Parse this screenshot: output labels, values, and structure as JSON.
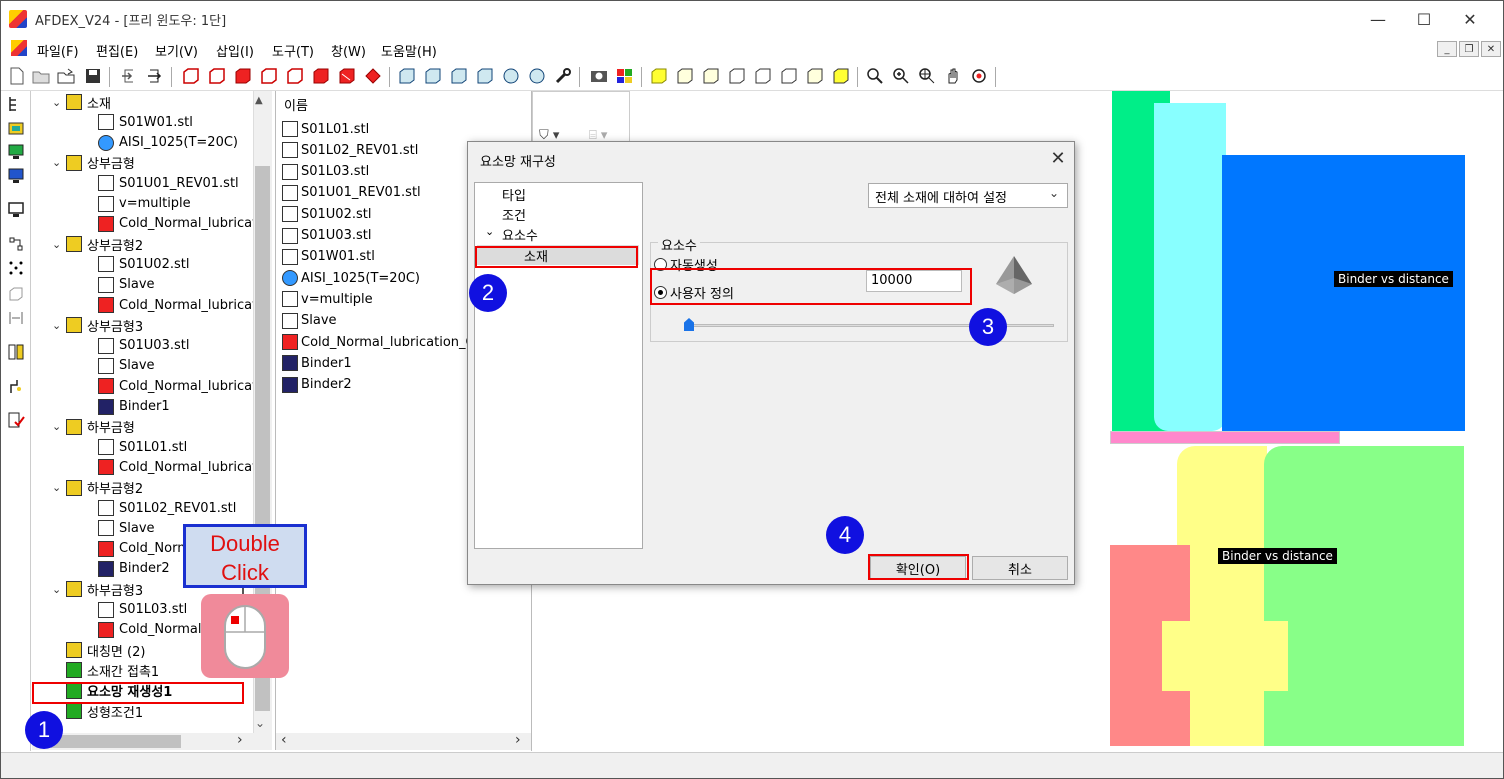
{
  "window": {
    "title": "AFDEX_V24 - [프리 윈도우: 1단]",
    "minimize": "—",
    "maximize": "☐",
    "close": "✕"
  },
  "menu": [
    "파일(F)",
    "편집(E)",
    "보기(V)",
    "삽입(I)",
    "도구(T)",
    "창(W)",
    "도움말(H)"
  ],
  "tree": {
    "nodes": [
      {
        "label": "소재",
        "level": 0,
        "icon": "material-cylinder-icon"
      },
      {
        "label": "S01W01.stl",
        "level": 1,
        "icon": "stl-file-icon"
      },
      {
        "label": "AISI_1025(T=20C)",
        "level": 1,
        "icon": "material-property-icon"
      },
      {
        "label": "상부금형",
        "level": 0,
        "icon": "upper-die-icon"
      },
      {
        "label": "S01U01_REV01.stl",
        "level": 1,
        "icon": "die-stl-icon"
      },
      {
        "label": "v=multiple",
        "level": 1,
        "icon": "press-icon"
      },
      {
        "label": "Cold_Normal_lubrication",
        "level": 1,
        "icon": "lubrication-icon"
      },
      {
        "label": "상부금형2",
        "level": 0,
        "icon": "upper-die-icon"
      },
      {
        "label": "S01U02.stl",
        "level": 1,
        "icon": "die-stl-icon"
      },
      {
        "label": "Slave",
        "level": 1,
        "icon": "press-icon"
      },
      {
        "label": "Cold_Normal_lubrication",
        "level": 1,
        "icon": "lubrication-icon"
      },
      {
        "label": "상부금형3",
        "level": 0,
        "icon": "upper-die-icon"
      },
      {
        "label": "S01U03.stl",
        "level": 1,
        "icon": "die-stl-icon"
      },
      {
        "label": "Slave",
        "level": 1,
        "icon": "press-icon"
      },
      {
        "label": "Cold_Normal_lubrication",
        "level": 1,
        "icon": "lubrication-icon"
      },
      {
        "label": "Binder1",
        "level": 1,
        "icon": "binder-icon"
      },
      {
        "label": "하부금형",
        "level": 0,
        "icon": "lower-die-icon"
      },
      {
        "label": "S01L01.stl",
        "level": 1,
        "icon": "die-stl-icon"
      },
      {
        "label": "Cold_Normal_lubrication",
        "level": 1,
        "icon": "lubrication-icon"
      },
      {
        "label": "하부금형2",
        "level": 0,
        "icon": "lower-die-icon"
      },
      {
        "label": "S01L02_REV01.stl",
        "level": 1,
        "icon": "die-stl-icon"
      },
      {
        "label": "Slave",
        "level": 1,
        "icon": "press-icon"
      },
      {
        "label": "Cold_Normal_lubrication",
        "level": 1,
        "icon": "lubrication-icon"
      },
      {
        "label": "Binder2",
        "level": 1,
        "icon": "binder-icon"
      },
      {
        "label": "하부금형3",
        "level": 0,
        "icon": "lower-die-icon"
      },
      {
        "label": "S01L03.stl",
        "level": 1,
        "icon": "die-stl-icon"
      },
      {
        "label": "Cold_Normal_lubrication",
        "level": 1,
        "icon": "lubrication-icon"
      },
      {
        "label": "대칭면 (2)",
        "level": 0,
        "icon": "symmetry-plane-icon"
      },
      {
        "label": "소재간 접촉1",
        "level": 0,
        "icon": "contact-icon"
      },
      {
        "label": "요소망 재생성1",
        "level": 0,
        "icon": "remesh-icon"
      },
      {
        "label": "성형조건1",
        "level": 0,
        "icon": "forming-condition-icon"
      }
    ]
  },
  "list": {
    "header": "이름",
    "rows": [
      {
        "label": "S01L01.stl",
        "icon": "stl-file-icon"
      },
      {
        "label": "S01L02_REV01.stl",
        "icon": "stl-file-icon"
      },
      {
        "label": "S01L03.stl",
        "icon": "stl-file-icon"
      },
      {
        "label": "S01U01_REV01.stl",
        "icon": "stl-file-icon"
      },
      {
        "label": "S01U02.stl",
        "icon": "stl-file-icon"
      },
      {
        "label": "S01U03.stl",
        "icon": "stl-file-icon"
      },
      {
        "label": "S01W01.stl",
        "icon": "stl-file-icon"
      },
      {
        "label": "AISI_1025(T=20C)",
        "icon": "material-property-icon"
      },
      {
        "label": "v=multiple",
        "icon": "press-icon"
      },
      {
        "label": "Slave",
        "icon": "press-icon"
      },
      {
        "label": "Cold_Normal_lubrication_Co",
        "icon": "lubrication-icon"
      },
      {
        "label": "Binder1",
        "icon": "binder-icon"
      },
      {
        "label": "Binder2",
        "icon": "binder-icon"
      }
    ]
  },
  "viewport": {
    "label_top": "Binder vs distance",
    "label_bottom": "Binder vs distance"
  },
  "dialog": {
    "title": "요소망 재구성",
    "close": "✕",
    "nav": [
      "타입",
      "조건",
      "요소수",
      "소재"
    ],
    "combo_value": "전체 소재에 대하여 설정",
    "group_label": "요소수",
    "radio_auto": "자동생성",
    "radio_user": "사용자 정의",
    "element_count": "10000",
    "ok": "확인(O)",
    "cancel": "취소"
  },
  "annotations": {
    "badges": [
      "1",
      "2",
      "3",
      "4"
    ],
    "callout_line1": "Double",
    "callout_line2": "Click"
  }
}
